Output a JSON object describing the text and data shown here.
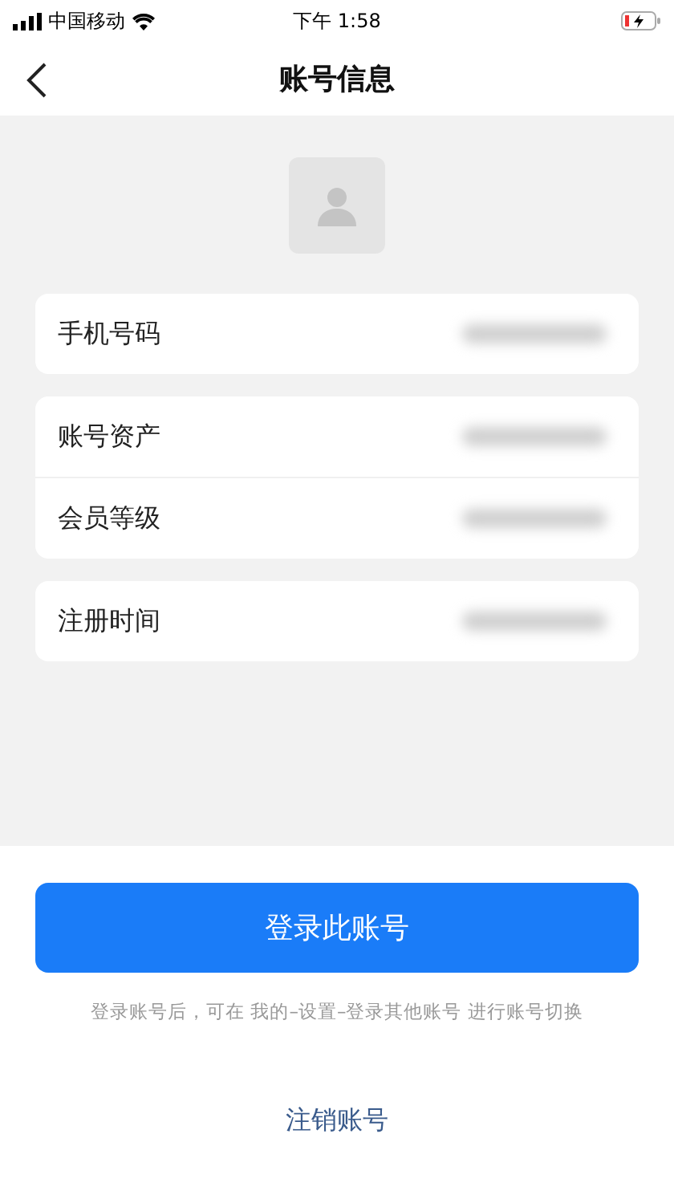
{
  "status_bar": {
    "carrier": "中国移动",
    "time": "下午 1:58"
  },
  "nav": {
    "title": "账号信息"
  },
  "groups": [
    {
      "rows": [
        {
          "label": "手机号码"
        }
      ]
    },
    {
      "rows": [
        {
          "label": "账号资产"
        },
        {
          "label": "会员等级"
        }
      ]
    },
    {
      "rows": [
        {
          "label": "注册时间"
        }
      ]
    }
  ],
  "login_button": "登录此账号",
  "hint": "登录账号后，可在 我的–设置–登录其他账号 进行账号切换",
  "cancel_link": "注销账号"
}
